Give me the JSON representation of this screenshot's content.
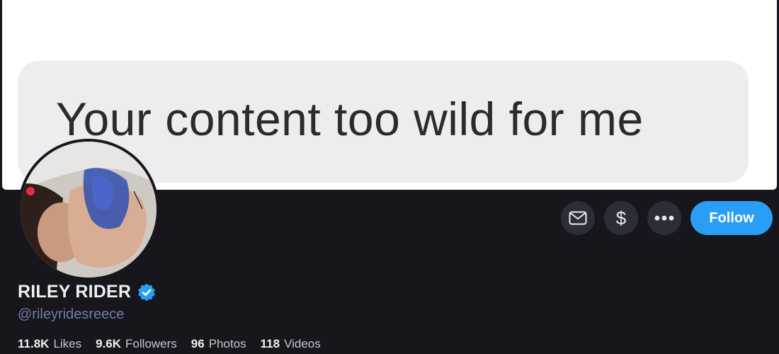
{
  "banner": {
    "message_text": "Your content too wild for me"
  },
  "profile": {
    "name": "RILEY RIDER",
    "handle": "@rileyridesreece",
    "verified": true,
    "avatar_icon": "profile-photo"
  },
  "actions": {
    "message_icon": "envelope-icon",
    "tip_icon": "dollar-icon",
    "tip_label": "$",
    "more_icon": "ellipsis-icon",
    "follow_label": "Follow"
  },
  "stats": [
    {
      "value": "11.8K",
      "label": "Likes"
    },
    {
      "value": "9.6K",
      "label": "Followers"
    },
    {
      "value": "96",
      "label": "Photos"
    },
    {
      "value": "118",
      "label": "Videos"
    }
  ],
  "colors": {
    "background": "#16161c",
    "accent": "#2a9df4",
    "handle": "#6e7ea8",
    "icon_button": "#2b2e37"
  }
}
